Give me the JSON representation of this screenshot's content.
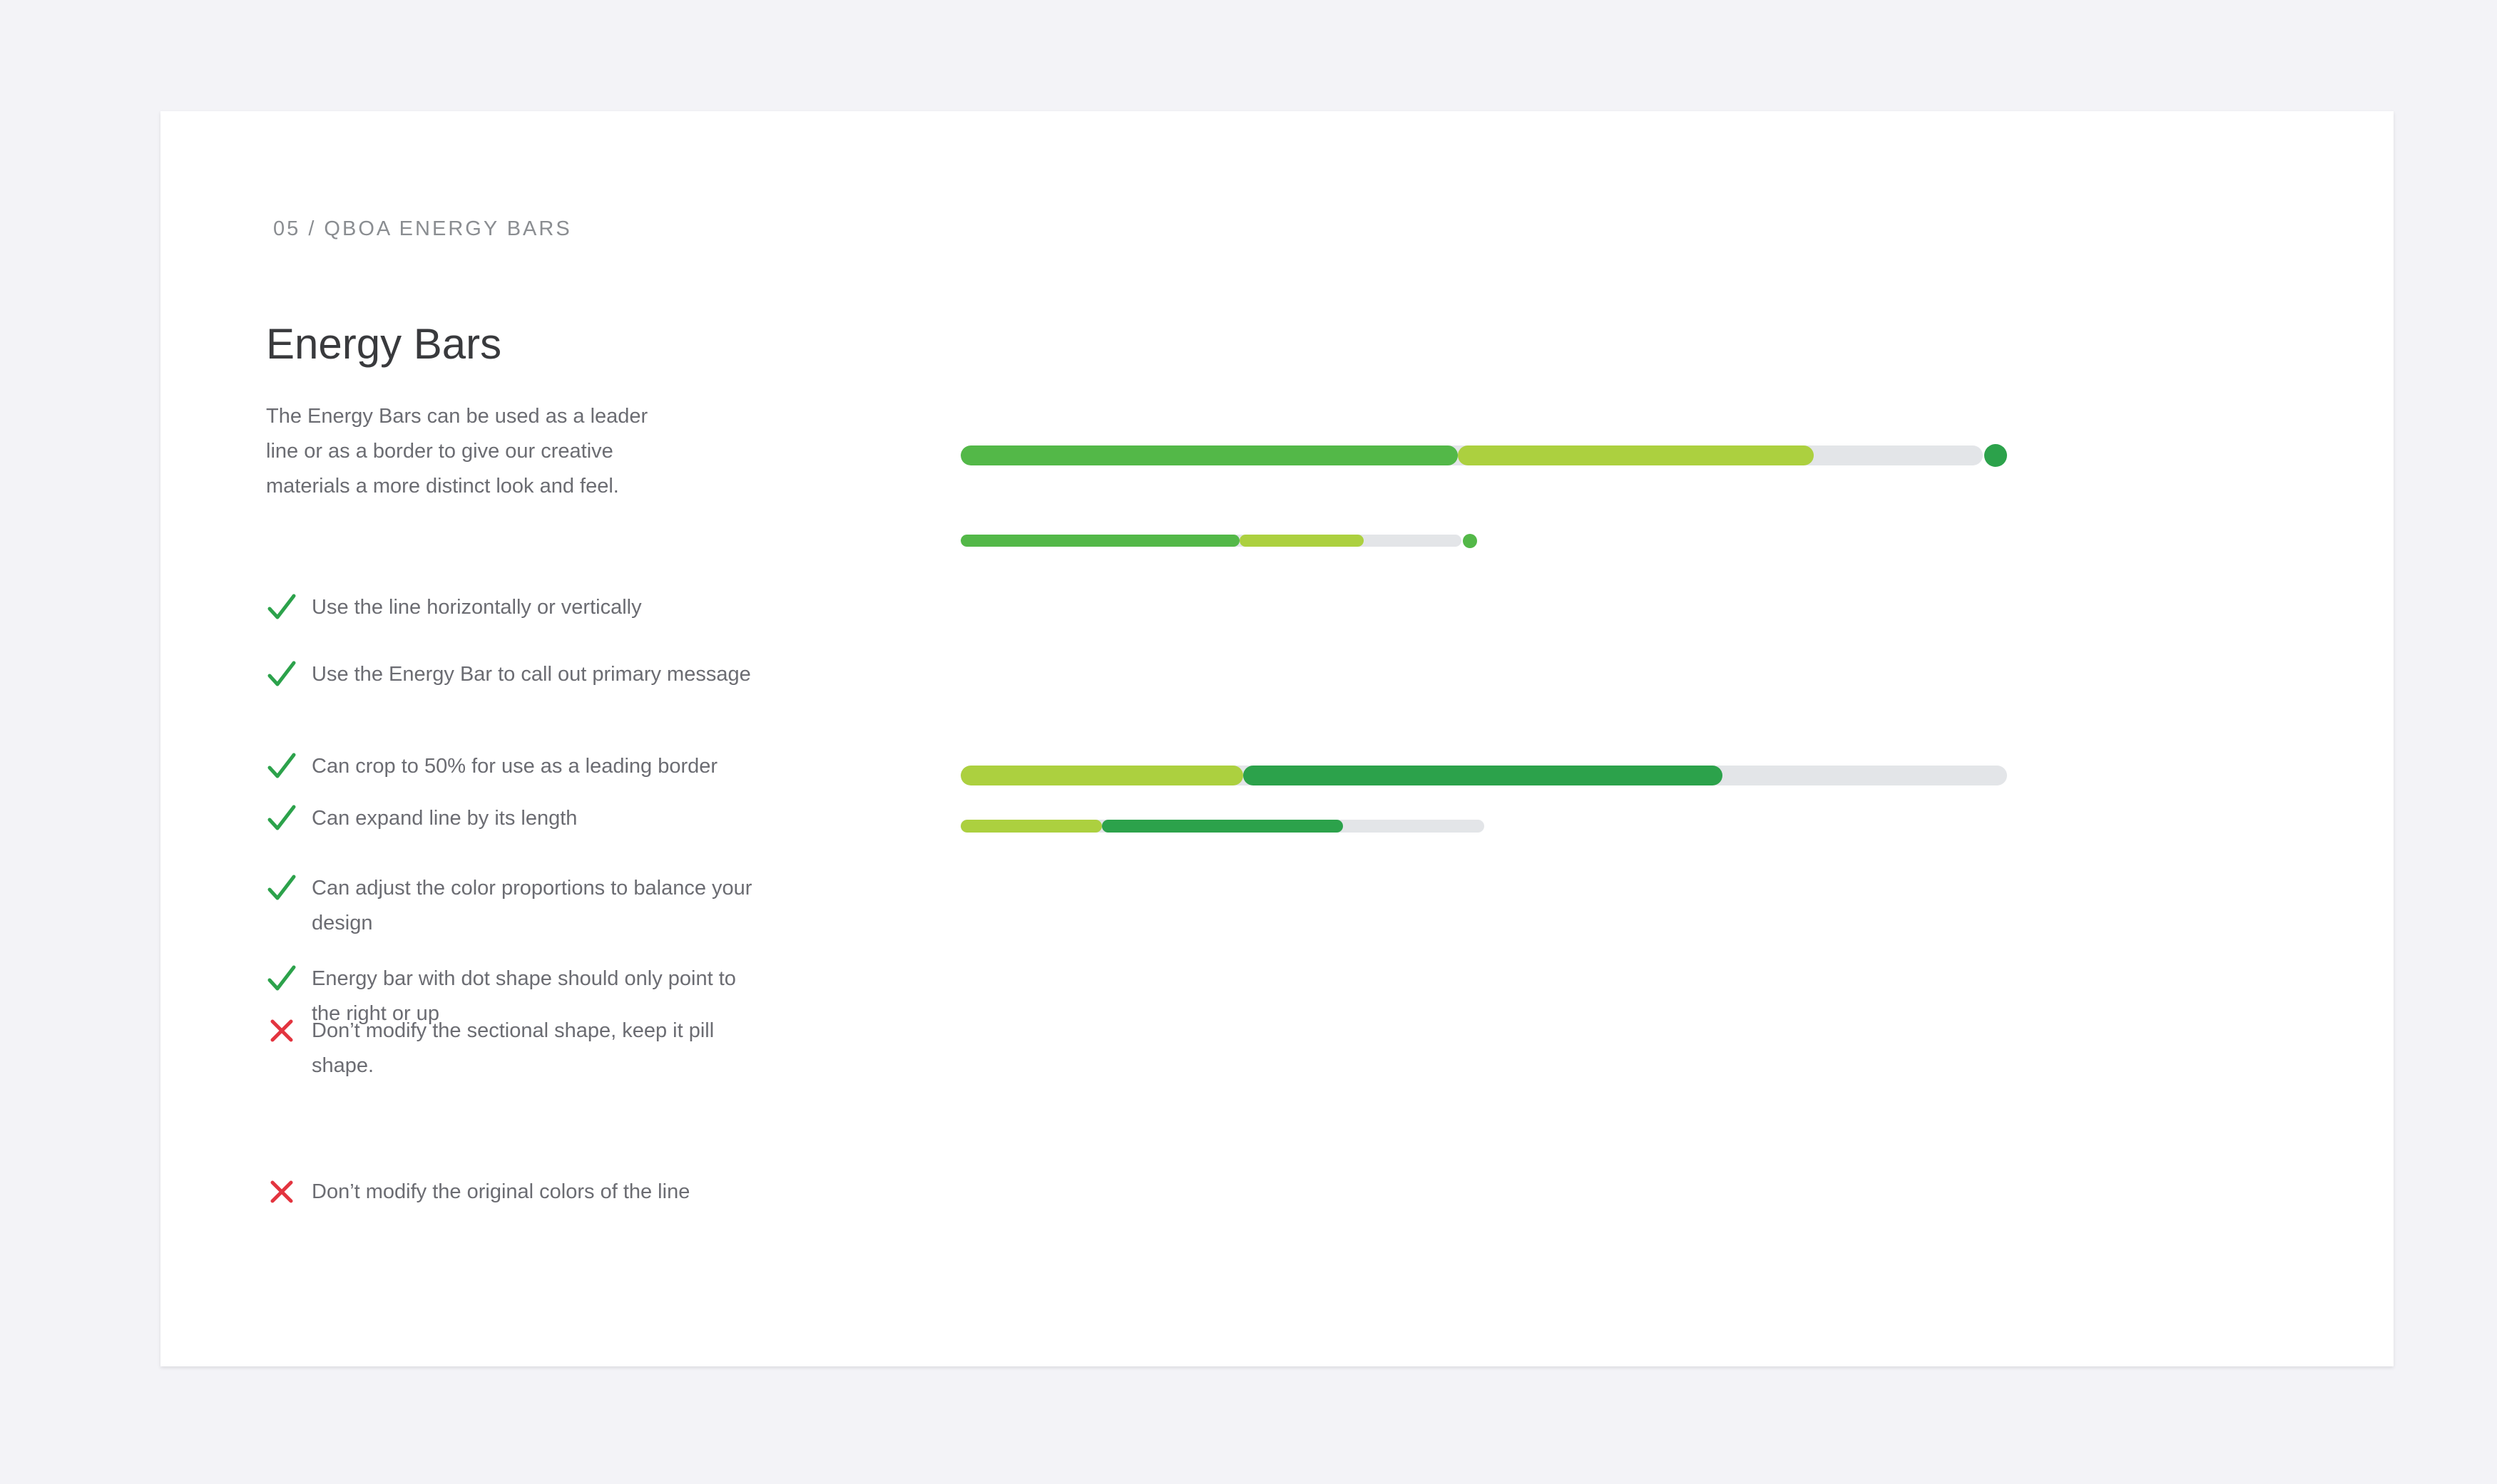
{
  "slide": {
    "eyebrow": "05 / QBOA ENERGY BARS",
    "title": "Energy Bars",
    "intro": "The Energy Bars can be used as a leader line or as a border to give our creative materials a more distinct look and feel."
  },
  "colors": {
    "green": "#53b848",
    "dark_green": "#2ca24b",
    "lime": "#acd03f",
    "track": "#e3e5e8",
    "check": "#2ca24b",
    "cross": "#e3343f"
  },
  "rules": [
    {
      "icon": "checkmark-icon",
      "text": "Use the line horizontally or vertically"
    },
    {
      "icon": "checkmark-icon",
      "text": "Use the Energy Bar to call out primary message"
    },
    {
      "icon": "checkmark-icon",
      "text": "Can crop to 50% for use as a leading border"
    },
    {
      "icon": "checkmark-icon",
      "text": "Can expand line by its length"
    },
    {
      "icon": "checkmark-icon",
      "text": "Can adjust the color proportions to balance your design"
    },
    {
      "icon": "checkmark-icon",
      "text": "Energy bar with dot shape should only point to the right or up"
    },
    {
      "icon": "cross-icon",
      "text": "Don’t modify the sectional shape, keep it pill shape."
    },
    {
      "icon": "cross-icon",
      "text": "Don’t modify the original colors of the line"
    }
  ],
  "energy_bars": [
    {
      "name": "energy-bar-dot-large",
      "dot": true,
      "segments": [
        {
          "color": "#53b848",
          "start": 0.0,
          "end": 0.475
        },
        {
          "color": "#acd03f",
          "start": 0.475,
          "end": 0.815
        }
      ]
    },
    {
      "name": "energy-bar-dot-small",
      "dot": true,
      "segments": [
        {
          "color": "#53b848",
          "start": 0.0,
          "end": 0.54
        },
        {
          "color": "#acd03f",
          "start": 0.54,
          "end": 0.78
        }
      ]
    },
    {
      "name": "energy-bar-plain-large",
      "dot": false,
      "segments": [
        {
          "color": "#acd03f",
          "start": 0.0,
          "end": 0.27
        },
        {
          "color": "#2ca24b",
          "start": 0.27,
          "end": 0.728
        }
      ]
    },
    {
      "name": "energy-bar-plain-small",
      "dot": false,
      "segments": [
        {
          "color": "#acd03f",
          "start": 0.0,
          "end": 0.27
        },
        {
          "color": "#2ca24b",
          "start": 0.27,
          "end": 0.73
        }
      ]
    }
  ]
}
